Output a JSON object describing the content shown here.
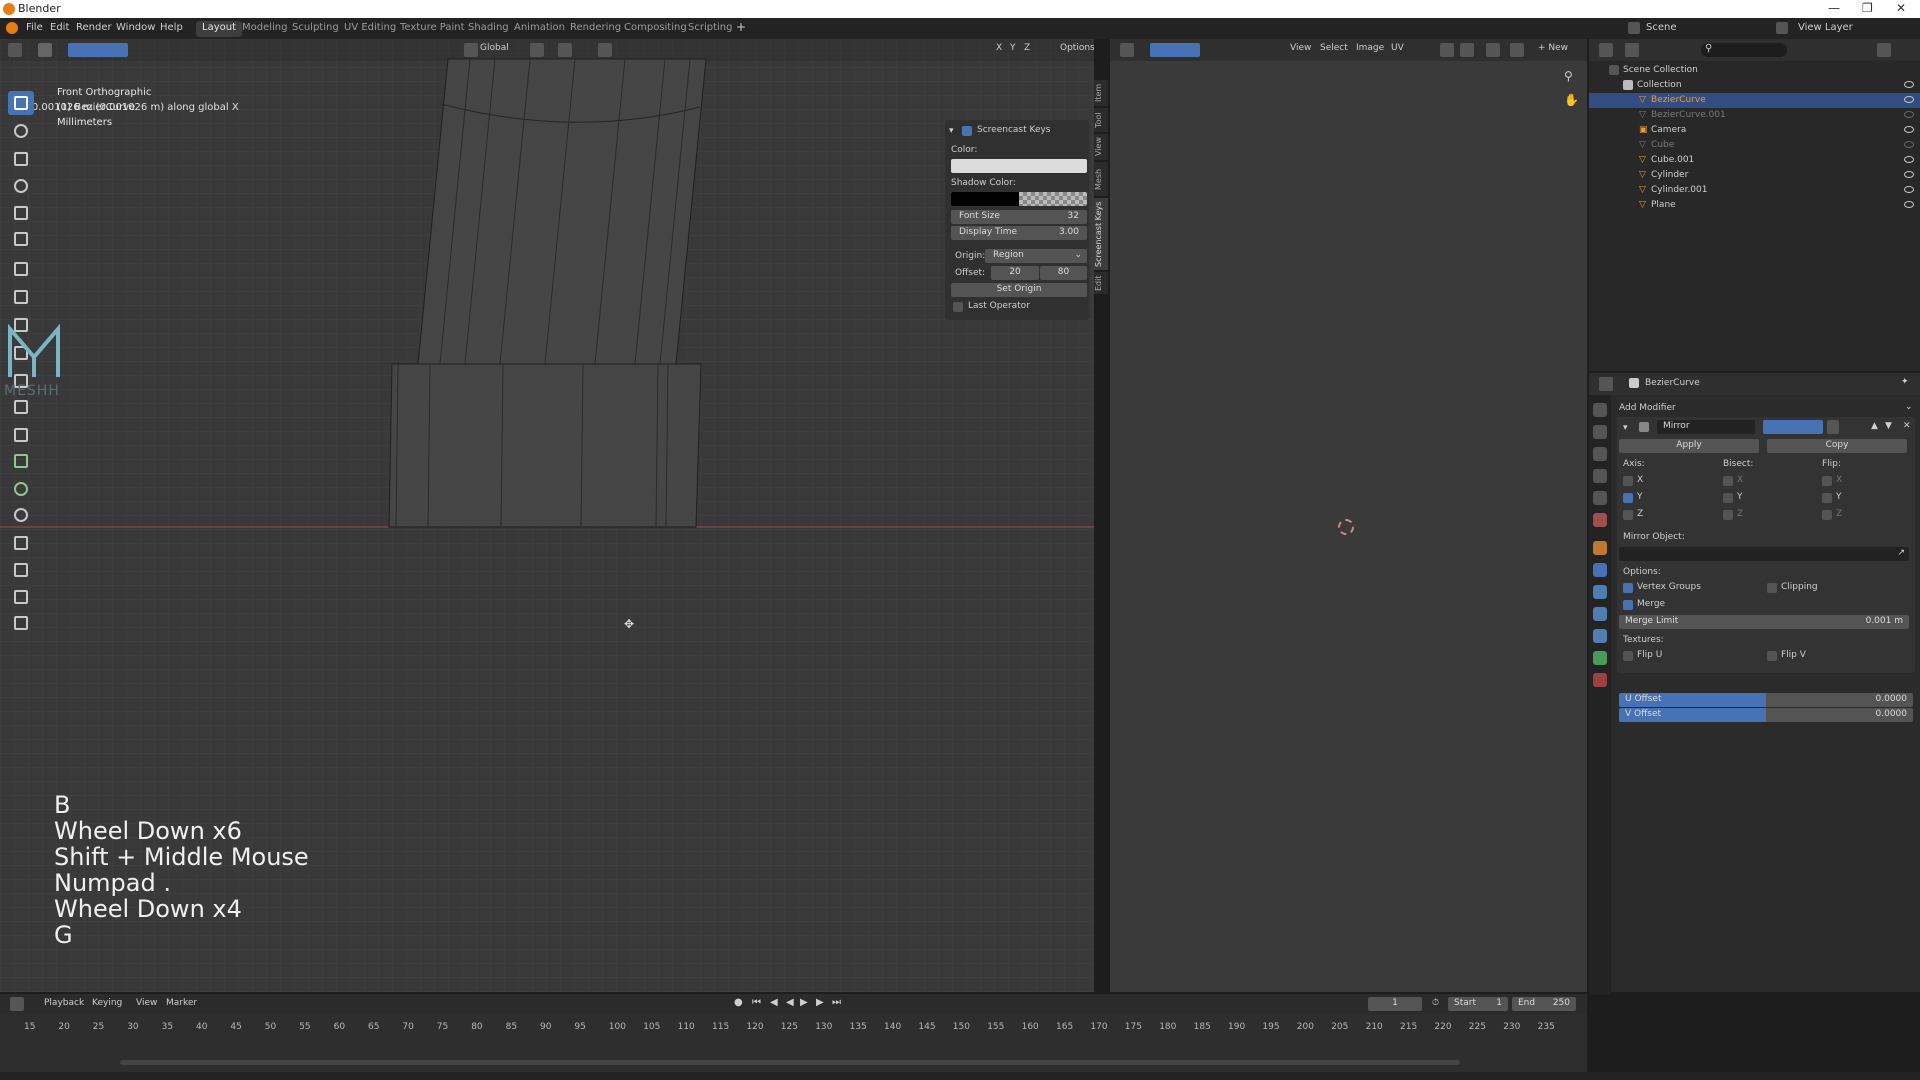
{
  "window": {
    "title": "Blender"
  },
  "menu": [
    "File",
    "Edit",
    "Render",
    "Window",
    "Help"
  ],
  "workspaces": [
    {
      "label": "Layout",
      "active": true
    },
    {
      "label": "Modeling"
    },
    {
      "label": "Sculpting"
    },
    {
      "label": "UV Editing"
    },
    {
      "label": "Texture Paint"
    },
    {
      "label": "Shading"
    },
    {
      "label": "Animation"
    },
    {
      "label": "Rendering"
    },
    {
      "label": "Compositing"
    },
    {
      "label": "Scripting"
    }
  ],
  "scene": {
    "name": "Scene",
    "view_layer": "View Layer"
  },
  "viewport": {
    "header": {
      "orientation": "Global",
      "options": "Options",
      "axes": [
        "X",
        "Y",
        "Z"
      ]
    },
    "operator_status": "D: -0.001026 m (0.001026 m) along global X",
    "info": [
      "Front Orthographic",
      "(1) BezierCurve",
      "Millimeters"
    ],
    "key_log": [
      "B",
      "Wheel Down x6",
      "Shift + Middle Mouse",
      "Numpad .",
      "Wheel Down x4",
      "G"
    ],
    "watermark": "MESHH"
  },
  "screencast_panel": {
    "title": "Screencast Keys",
    "color_label": "Color:",
    "shadow_label": "Shadow Color:",
    "font_size_label": "Font Size",
    "font_size": "32",
    "display_time_label": "Display Time",
    "display_time": "3.00",
    "origin_label": "Origin:",
    "origin": "Region",
    "offset_label": "Offset:",
    "offset_x": "20",
    "offset_y": "80",
    "set_origin": "Set Origin",
    "last_operator": "Last Operator",
    "tabs": [
      "Item",
      "Tool",
      "View",
      "Mesh",
      "Screencast Keys",
      "Edit"
    ]
  },
  "image_editor": {
    "menus": [
      "View",
      "Select",
      "Image",
      "UV"
    ],
    "new_label": "New"
  },
  "outliner": {
    "root": "Scene Collection",
    "collection": "Collection",
    "items": [
      {
        "name": "BezierCurve",
        "selected": true
      },
      {
        "name": "BezierCurve.001",
        "dim": true
      },
      {
        "name": "Camera"
      },
      {
        "name": "Cube",
        "dim": true
      },
      {
        "name": "Cube.001"
      },
      {
        "name": "Cylinder"
      },
      {
        "name": "Cylinder.001"
      },
      {
        "name": "Plane"
      }
    ]
  },
  "properties": {
    "object": "BezierCurve",
    "add_modifier": "Add Modifier",
    "modifier_name": "Mirror",
    "apply": "Apply",
    "copy": "Copy",
    "axis_label": "Axis:",
    "bisect_label": "Bisect:",
    "flip_label": "Flip:",
    "axes": [
      "X",
      "Y",
      "Z"
    ],
    "axis_checked": [
      false,
      true,
      false
    ],
    "mirror_object_label": "Mirror Object:",
    "options_label": "Options:",
    "vertex_groups": "Vertex Groups",
    "clipping": "Clipping",
    "merge": "Merge",
    "merge_limit_label": "Merge Limit",
    "merge_limit": "0.001 m",
    "textures_label": "Textures:",
    "flip_u": "Flip U",
    "flip_v": "Flip V",
    "u_offset_label": "U Offset",
    "u_offset": "0.0000",
    "v_offset_label": "V Offset",
    "v_offset": "0.0000"
  },
  "timeline": {
    "menus": [
      "Playback",
      "Keying",
      "View",
      "Marker"
    ],
    "current_frame": "1",
    "start_label": "Start",
    "start": "1",
    "end_label": "End",
    "end": "250",
    "ticks": [
      "15",
      "20",
      "25",
      "30",
      "35",
      "40",
      "45",
      "50",
      "55",
      "60",
      "65",
      "70",
      "75",
      "80",
      "85",
      "90",
      "95",
      "100",
      "105",
      "110",
      "115",
      "120",
      "125",
      "130",
      "135",
      "140",
      "145",
      "150",
      "155",
      "160",
      "165",
      "170",
      "175",
      "180",
      "185",
      "190",
      "195",
      "200",
      "205",
      "210",
      "215",
      "220",
      "225",
      "230",
      "235"
    ]
  },
  "colors": {
    "accent": "#4772b3",
    "selected_row": "#334d80",
    "x_axis": "#9a4a4a"
  }
}
